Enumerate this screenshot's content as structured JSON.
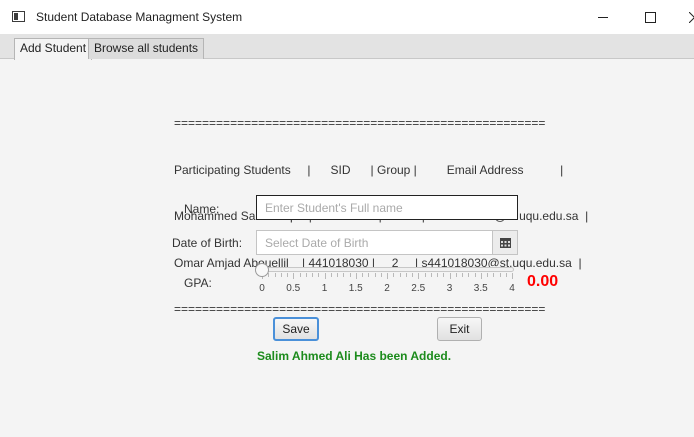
{
  "window": {
    "title": "Student Database Managment System"
  },
  "tabs": [
    {
      "label": "Add Student",
      "active": true
    },
    {
      "label": "Browse all students",
      "active": false
    }
  ],
  "info_table": {
    "lines": [
      "=====================================================",
      "Participating Students     |      SID      | Group |         Email Address           |",
      "Mohammed Sami Soqati | 441010207 |     2     | s441010207@st.uqu.edu.sa  |",
      "Omar Amjad Abouellil    | 441018030 |     2     | s441018030@st.uqu.edu.sa  |",
      "====================================================="
    ]
  },
  "form": {
    "name_label": "Name:",
    "name_placeholder": "Enter Student's Full name",
    "dob_label": "Date of Birth:",
    "dob_placeholder": "Select Date of Birth",
    "gpa_label": "GPA:",
    "gpa_value": "0.00",
    "gpa_slider": {
      "min": 0,
      "max": 4,
      "value": 0,
      "tick_labels": [
        "0",
        "0.5",
        "1",
        "1.5",
        "2",
        "2.5",
        "3",
        "3.5",
        "4"
      ]
    }
  },
  "buttons": {
    "save_label": "Save",
    "exit_label": "Exit"
  },
  "status_message": "Salim Ahmed Ali Has been Added.",
  "colors": {
    "gpa_value": "#ff0000",
    "status_message": "#1c8b1c",
    "focus_ring": "#4a90d9"
  },
  "icons": {
    "app": "window-icon",
    "calendar": "calendar-icon"
  }
}
